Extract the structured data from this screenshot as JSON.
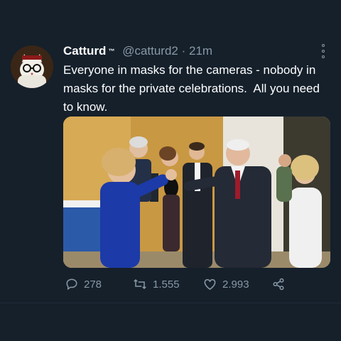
{
  "tweet": {
    "author_name": "Catturd",
    "author_badge": "™",
    "handle": "@catturd2",
    "separator": "·",
    "time": "21m",
    "text": "Everyone in masks for the cameras - nobody in masks for the private celebrations.  All you need to know.",
    "stats": {
      "replies": "278",
      "retweets": "1.555",
      "likes": "2.993"
    }
  },
  "colors": {
    "background": "#15202b",
    "secondary_text": "#8899a6",
    "primary_text": "#ffffff"
  },
  "icons": [
    "avatar-cat",
    "more-icon",
    "reply-icon",
    "retweet-icon",
    "like-icon",
    "share-icon"
  ]
}
